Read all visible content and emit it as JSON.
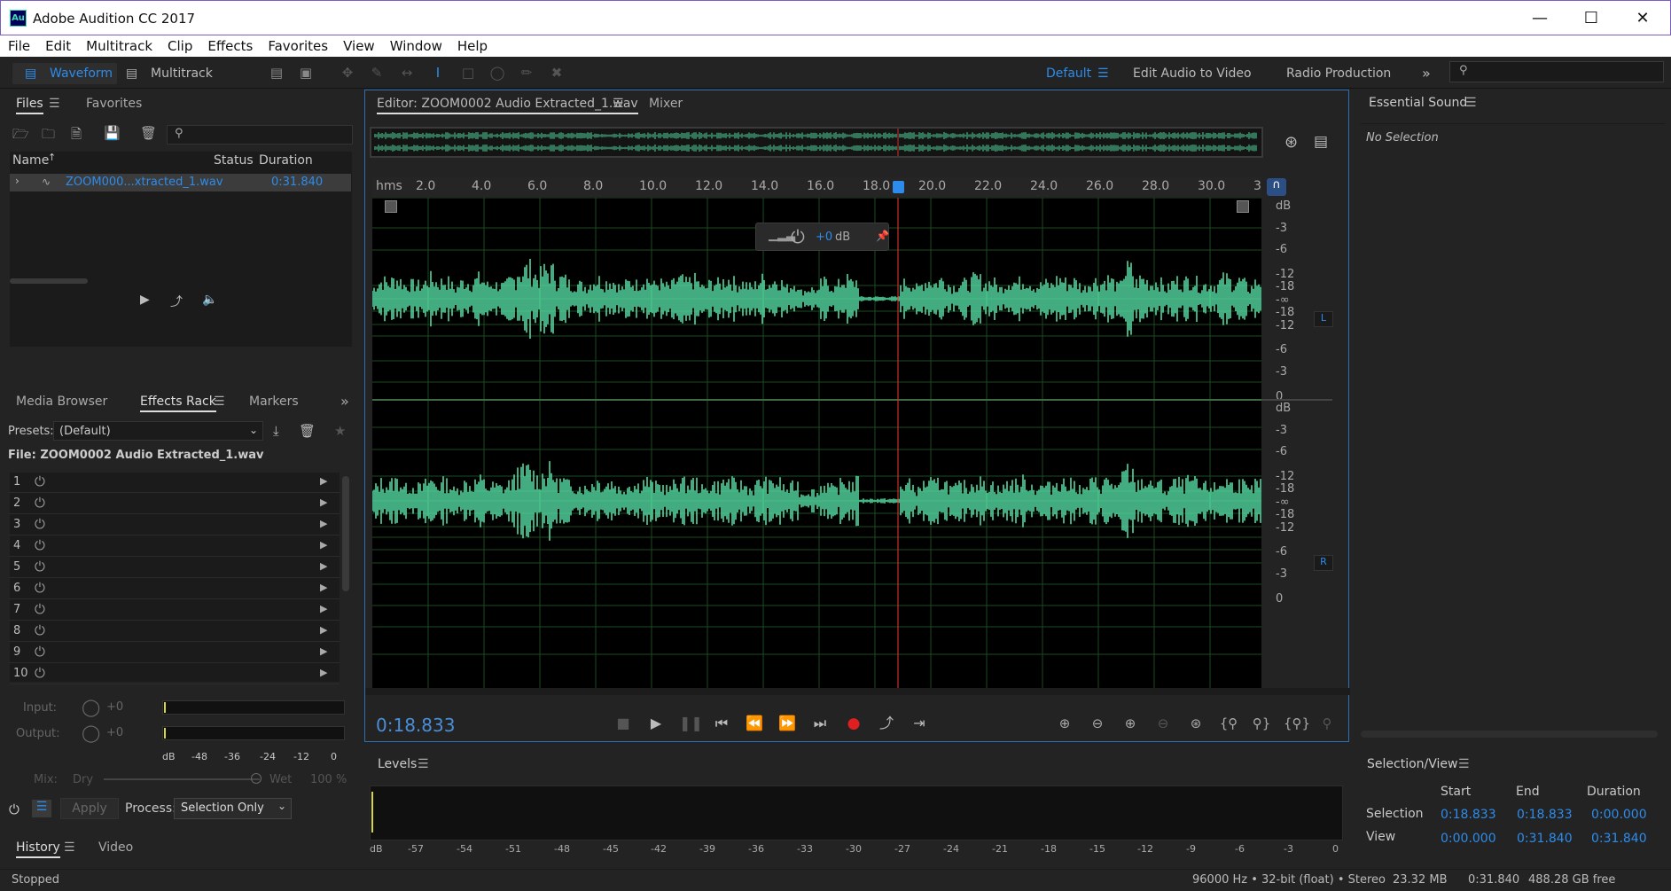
{
  "window": {
    "title": "Adobe Audition CC 2017",
    "icon_text": "Au"
  },
  "menu": [
    "File",
    "Edit",
    "Multitrack",
    "Clip",
    "Effects",
    "Favorites",
    "View",
    "Window",
    "Help"
  ],
  "toolbar": {
    "waveform": "Waveform",
    "multitrack": "Multitrack",
    "workspaces": [
      "Default",
      "Edit Audio to Video",
      "Radio Production"
    ]
  },
  "files_panel": {
    "tabs": [
      "Files",
      "Favorites"
    ],
    "columns": [
      "Name",
      "Status",
      "Duration"
    ],
    "file": {
      "name": "ZOOM000...xtracted_1.wav",
      "duration": "0:31.840"
    }
  },
  "effects_panel": {
    "tabs": [
      "Media Browser",
      "Effects Rack",
      "Markers"
    ],
    "presets_label": "Presets:",
    "preset_value": "(Default)",
    "file_label": "File: ZOOM0002 Audio Extracted_1.wav",
    "slots": [
      "1",
      "2",
      "3",
      "4",
      "5",
      "6",
      "7",
      "8",
      "9",
      "10"
    ],
    "input_label": "Input:",
    "output_label": "Output:",
    "input_val": "+0",
    "output_val": "+0",
    "meter_scale": [
      "dB",
      "-48",
      "-36",
      "-24",
      "-12",
      "0"
    ],
    "mix_label": "Mix:",
    "dry": "Dry",
    "wet": "Wet",
    "wet_pct": "100 %",
    "apply": "Apply",
    "process_label": "Process:",
    "process_value": "Selection Only"
  },
  "history_panel": {
    "tabs": [
      "History",
      "Video"
    ]
  },
  "editor": {
    "tab": "Editor: ZOOM0002 Audio Extracted_1.wav",
    "mixer": "Mixer",
    "time_unit": "hms",
    "ticks": [
      "2.0",
      "4.0",
      "6.0",
      "8.0",
      "10.0",
      "12.0",
      "14.0",
      "16.0",
      "18.0",
      "20.0",
      "22.0",
      "24.0",
      "26.0",
      "28.0",
      "30.0",
      "3"
    ],
    "hud_gain": "+0",
    "hud_unit": "dB",
    "db_top": [
      "dB",
      "-3",
      "-6",
      "-12",
      "-18",
      "-∞",
      "-18",
      "-12",
      "-6",
      "-3",
      "0"
    ],
    "db_bottom": [
      "dB",
      "-3",
      "-6",
      "-12",
      "-18",
      "-∞",
      "-18",
      "-12",
      "-6",
      "-3",
      "0"
    ],
    "ch_left": "L",
    "ch_right": "R",
    "current_time": "0:18.833",
    "playhead_seconds": 18.833,
    "duration_seconds": 31.84
  },
  "essential_sound": {
    "title": "Essential Sound",
    "status": "No Selection"
  },
  "levels": {
    "title": "Levels",
    "scale": [
      "dB",
      "-57",
      "-54",
      "-51",
      "-48",
      "-45",
      "-42",
      "-39",
      "-36",
      "-33",
      "-30",
      "-27",
      "-24",
      "-21",
      "-18",
      "-15",
      "-12",
      "-9",
      "-6",
      "-3",
      "0"
    ]
  },
  "selection_view": {
    "title": "Selection/View",
    "headers": [
      "Start",
      "End",
      "Duration"
    ],
    "rows": [
      {
        "label": "Selection",
        "start": "0:18.833",
        "end": "0:18.833",
        "duration": "0:00.000"
      },
      {
        "label": "View",
        "start": "0:00.000",
        "end": "0:31.840",
        "duration": "0:31.840"
      }
    ]
  },
  "status": {
    "left": "Stopped",
    "format": "96000 Hz • 32-bit (float) • Stereo",
    "size": "23.32 MB",
    "duration": "0:31.840",
    "free": "488.28 GB free"
  },
  "colors": {
    "wave": "#52d8a0",
    "accent": "#2d8ceb",
    "playhead": "#cc2f2f",
    "record": "#e02020"
  }
}
